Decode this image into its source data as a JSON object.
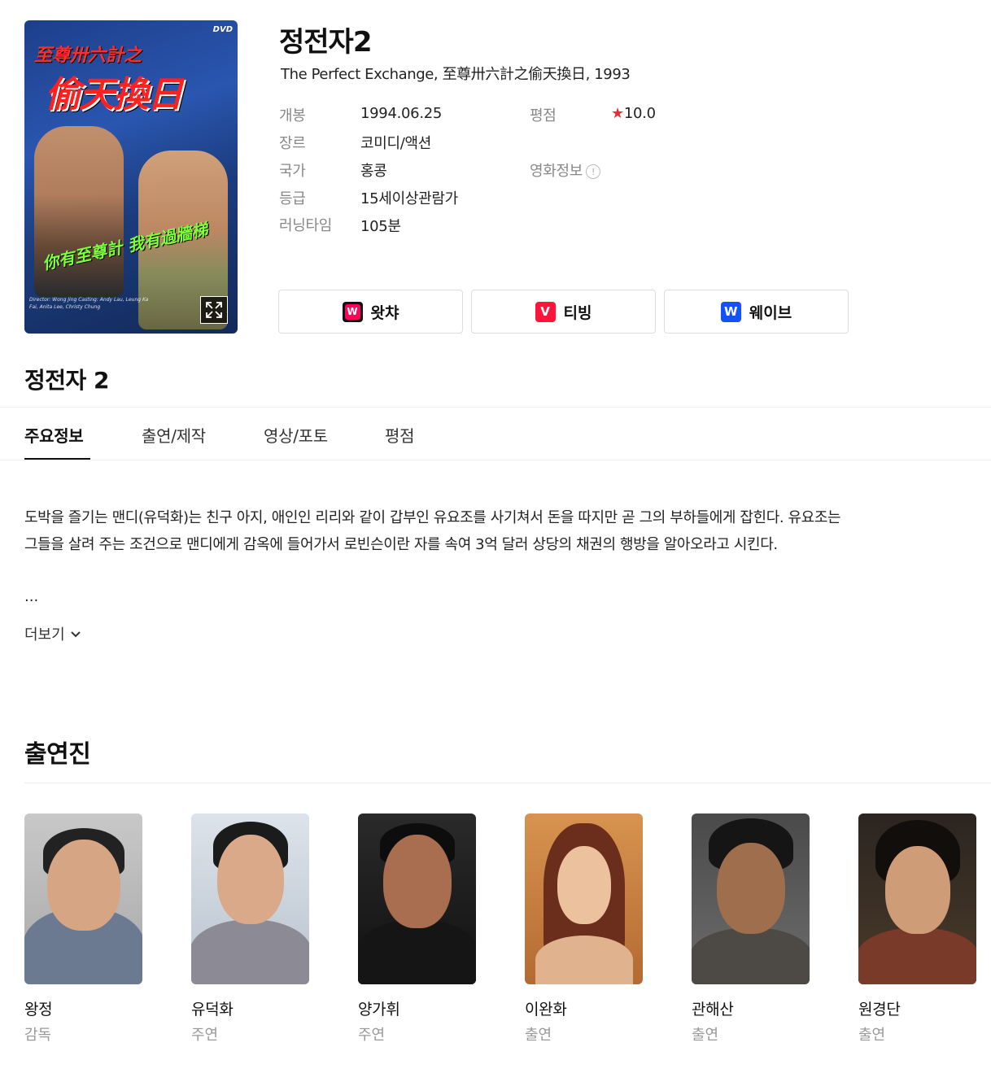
{
  "movie": {
    "title": "정전자2",
    "subtitle": "The Perfect Exchange, 至尊卅六計之偷天換日, 1993",
    "poster": {
      "dvd_mark": "DVD",
      "title_small": "至尊卅六計之",
      "title_big": "偷天換日",
      "slogan": "你有至尊計 我有過牆梯",
      "credit": "Director: Wong Jing Casting: Andy Lau, Leung Ka Fai, Anita Lee, Christy Chung"
    }
  },
  "info": {
    "release_label": "개봉",
    "release_value": "1994.06.25",
    "genre_label": "장르",
    "genre_value": "코미디/액션",
    "country_label": "국가",
    "country_value": "홍콩",
    "rating_label": "등급",
    "rating_value": "15세이상관람가",
    "runtime_label": "러닝타임",
    "runtime_value": "105분",
    "score_label": "평점",
    "score_star": "★",
    "score_value": "10.0",
    "movieinfo_label": "영화정보",
    "notice_icon": "!"
  },
  "ott": [
    {
      "label": "왓챠",
      "logo": "W",
      "color": "#ff0558",
      "icon": "watcha-icon"
    },
    {
      "label": "티빙",
      "logo": "V",
      "color": "#ff153c",
      "icon": "tving-icon"
    },
    {
      "label": "웨이브",
      "logo": "W",
      "color": "#1351f9",
      "icon": "wavve-icon"
    }
  ],
  "section_title": "정전자 2",
  "tabs": [
    {
      "label": "주요정보"
    },
    {
      "label": "출연/제작"
    },
    {
      "label": "영상/포토"
    },
    {
      "label": "평점"
    }
  ],
  "synopsis": {
    "text": "도박을 즐기는 맨디(유덕화)는 친구 아지, 애인인 리리와 같이 갑부인 유요조를 사기쳐서 돈을 따지만 곧 그의 부하들에게 잡힌다. 유요조는 그들을 살려 주는 조건으로 맨디에게 감옥에 들어가서 로빈슨이란 자를 속여 3억 달러 상당의 채권의 행방을 알아오라고 시킨다.",
    "ellipsis": "...",
    "more_label": "더보기"
  },
  "cast_title": "출연진",
  "cast": [
    {
      "name": "왕정",
      "role": "감독"
    },
    {
      "name": "유덕화",
      "role": "주연"
    },
    {
      "name": "양가휘",
      "role": "주연"
    },
    {
      "name": "이완화",
      "role": "출연"
    },
    {
      "name": "관해산",
      "role": "출연"
    },
    {
      "name": "원경단",
      "role": "출연"
    }
  ]
}
